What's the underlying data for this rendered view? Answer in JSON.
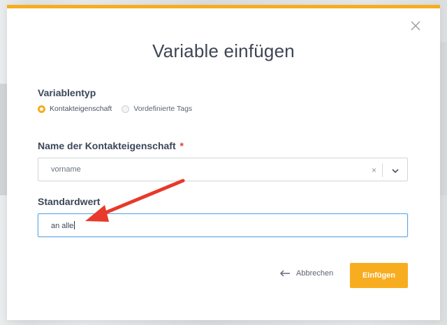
{
  "dialog": {
    "title": "Variable einfügen",
    "close_icon": "close-icon",
    "accent_color": "#f7ad1f"
  },
  "variable_type": {
    "label": "Variablentyp",
    "options": [
      {
        "label": "Kontakteigenschaft",
        "selected": true
      },
      {
        "label": "Vordefinierte Tags",
        "selected": false
      }
    ]
  },
  "property": {
    "label": "Name der Kontakteigenschaft",
    "required_marker": "*",
    "selected_value": "vorname",
    "clear_symbol": "×"
  },
  "default_value": {
    "label": "Standardwert",
    "value": "an alle",
    "focus_color": "#5aa6e6"
  },
  "annotation": {
    "arrow_color": "#e8392b"
  },
  "actions": {
    "cancel_label": "Abbrechen",
    "submit_label": "Einfügen"
  }
}
